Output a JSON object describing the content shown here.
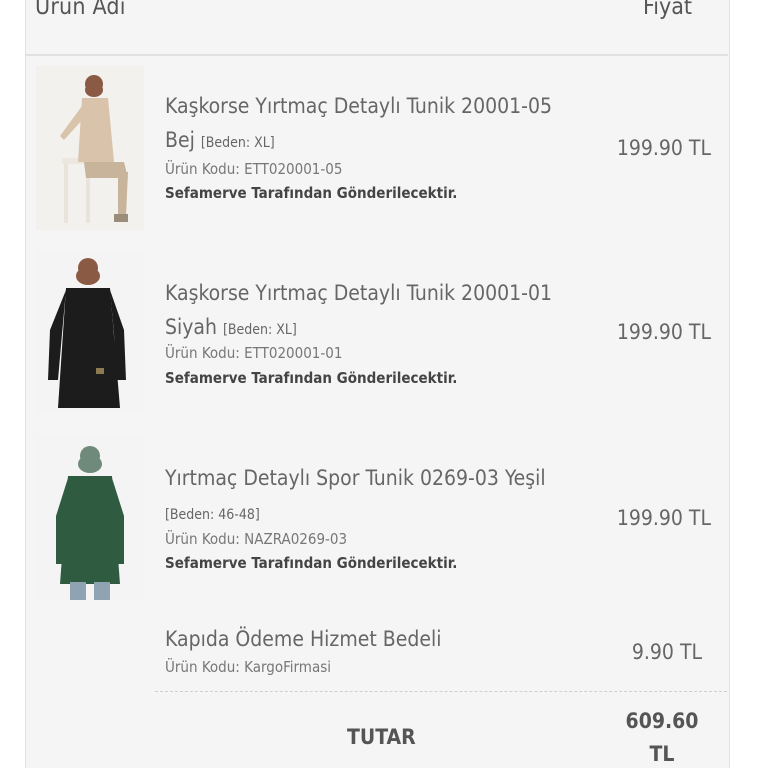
{
  "header": {
    "product_name_col": "Ürün Adı",
    "price_col": "Fiyat"
  },
  "items": [
    {
      "title": "Kaşkorse Yırtmaç Detaylı Tunik 20001-05 Bej",
      "size_label": "[Beden: XL]",
      "code": "Ürün Kodu: ETT020001-05",
      "seller": "Sefamerve Tarafından Gönderilecektir.",
      "price": "199.90 TL",
      "color": "#d9c3aa"
    },
    {
      "title": "Kaşkorse Yırtmaç Detaylı Tunik 20001-01 Siyah",
      "size_label": "[Beden: XL]",
      "code": "Ürün Kodu: ETT020001-01",
      "seller": "Sefamerve Tarafından Gönderilecektir.",
      "price": "199.90 TL",
      "color": "#1c1c1c"
    },
    {
      "title": "Yırtmaç Detaylı Spor Tunik 0269-03 Yeşil",
      "size_label": "[Beden: 46-48]",
      "code": "Ürün Kodu: NAZRA0269-03",
      "seller": "Sefamerve Tarafından Gönderilecektir.",
      "price": "199.90 TL",
      "color": "#2f5c40"
    }
  ],
  "service_fee": {
    "title": "Kapıda Ödeme Hizmet Bedeli",
    "code": "Ürün Kodu: KargoFirmasi",
    "price": "9.90 TL"
  },
  "total": {
    "label": "TUTAR",
    "amount": "609.60 TL"
  }
}
